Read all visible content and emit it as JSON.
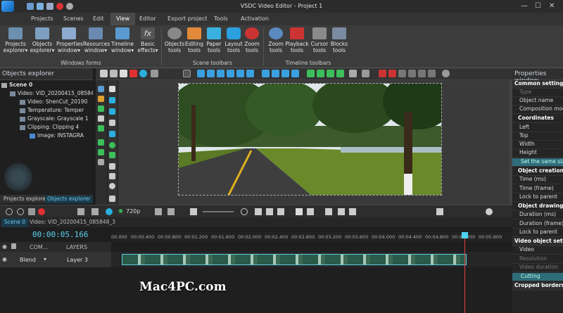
{
  "app": {
    "title": "VSDC Video Editor - Project 1"
  },
  "menu": [
    "Projects",
    "Scenes",
    "Edit",
    "View",
    "Editor",
    "Export project",
    "Tools",
    "Activation"
  ],
  "ribbon": {
    "buttons": [
      {
        "label": "Projects explorer",
        "arrow": "▾"
      },
      {
        "label": "Objects explorer",
        "arrow": "▾"
      },
      {
        "label": "Properties window",
        "arrow": "▾"
      },
      {
        "label": "Resources window",
        "arrow": "▾"
      },
      {
        "label": "Timeline window",
        "arrow": "▾"
      },
      {
        "label": "Basic effects",
        "arrow": "▾"
      },
      {
        "label": "Objects tools"
      },
      {
        "label": "Editing tools"
      },
      {
        "label": "Paper tools"
      },
      {
        "label": "Layout tools"
      },
      {
        "label": "Zoom tools"
      },
      {
        "label": "Zoom tools"
      },
      {
        "label": "Playback tools"
      },
      {
        "label": "Cursor tools"
      },
      {
        "label": "Blocks tools"
      }
    ],
    "groups": [
      "Windows forms",
      "Scene toolbars",
      "Timeline toolbars"
    ]
  },
  "objects_explorer": {
    "title": "Objects explorer",
    "items": [
      "Scene 0",
      "Video: VID_20200415_08584",
      "Video: ShenCut_20190",
      "Temperature: Temper",
      "Grayscale: Grayscale 1",
      "Clipping: Clipping 4",
      "Image: INSTAGRA"
    ]
  },
  "panel_tabs": [
    "Projects explorer",
    "Objects explorer"
  ],
  "properties": {
    "title": "Properties window",
    "rows": [
      {
        "t": "Common settings",
        "k": "sec"
      },
      {
        "t": "Type",
        "k": "dim"
      },
      {
        "t": "Object name",
        "k": ""
      },
      {
        "t": "Composition mode",
        "k": ""
      },
      {
        "t": "Coordinates",
        "k": "sec2"
      },
      {
        "t": "Left",
        "k": ""
      },
      {
        "t": "Top",
        "k": ""
      },
      {
        "t": "Width",
        "k": ""
      },
      {
        "t": "Height",
        "k": ""
      },
      {
        "t": "Set the same size",
        "k": "btn"
      },
      {
        "t": "Object creation",
        "k": "sec2"
      },
      {
        "t": "Time (ms)",
        "k": ""
      },
      {
        "t": "Time (frame)",
        "k": ""
      },
      {
        "t": "Lock to parent",
        "k": ""
      },
      {
        "t": "Object drawing",
        "k": "sec2"
      },
      {
        "t": "Duration (ms)",
        "k": ""
      },
      {
        "t": "Duration (frame)",
        "k": ""
      },
      {
        "t": "Lock to parent",
        "k": ""
      },
      {
        "t": "Video object settings",
        "k": "sec"
      },
      {
        "t": "Video",
        "k": ""
      },
      {
        "t": "Resolution",
        "k": "dim"
      },
      {
        "t": "Video duration",
        "k": "dim"
      },
      {
        "t": "Cutting",
        "k": "btn"
      },
      {
        "t": "Cropped borders",
        "k": "sec"
      }
    ]
  },
  "playback": {
    "resolution": "720p"
  },
  "timeline_tabs": [
    "Scene 0",
    "Video: VID_20200415_085848_3"
  ],
  "timeline": {
    "timecode": "00:00:05.166",
    "ticks": [
      "00.000",
      "00:00.400",
      "00:00.800",
      "00:01.200",
      "00:01.600",
      "00:02.000",
      "00:02.400",
      "00:02.800",
      "00:03.200",
      "00:03.600",
      "00:04.000",
      "00:04.400",
      "00:04.800",
      "00:05.200",
      "00:05.600"
    ],
    "header_com": "COM...",
    "header_layers": "LAYERS",
    "track": {
      "blend": "Blend",
      "layer": "Layer 3"
    }
  },
  "watermark": "Mac4PC.com"
}
